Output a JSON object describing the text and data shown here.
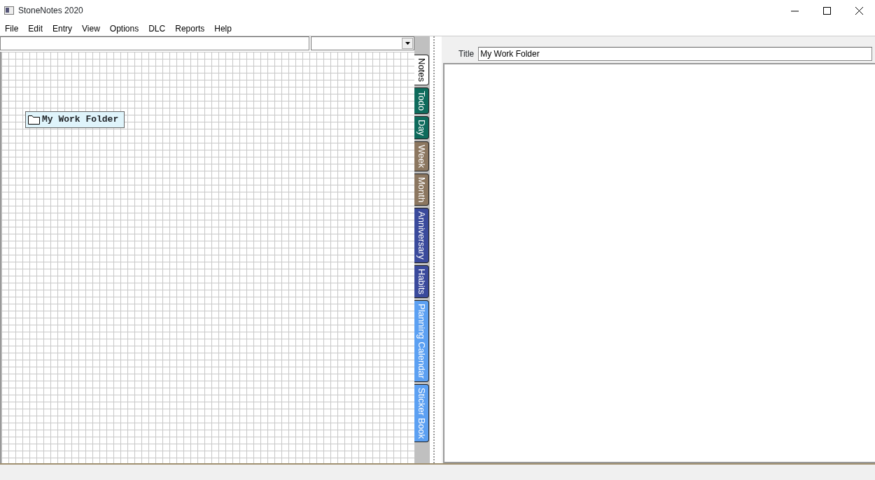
{
  "window": {
    "title": "StoneNotes 2020"
  },
  "menu": [
    "File",
    "Edit",
    "Entry",
    "View",
    "Options",
    "DLC",
    "Reports",
    "Help"
  ],
  "canvas": {
    "items": [
      {
        "kind": "folder",
        "label": "My Work Folder",
        "selected": true
      }
    ]
  },
  "tabs": [
    {
      "label": "Notes",
      "selected": true,
      "color": "#ffffff"
    },
    {
      "label": "Todo",
      "selected": false,
      "color": "#0e6b5c"
    },
    {
      "label": "Day",
      "selected": false,
      "color": "#0e6b5c"
    },
    {
      "label": "Week",
      "selected": false,
      "color": "#8c7760"
    },
    {
      "label": "Month",
      "selected": false,
      "color": "#8c7760"
    },
    {
      "label": "Anniversary",
      "selected": false,
      "color": "#3a4a9c"
    },
    {
      "label": "Habits",
      "selected": false,
      "color": "#3a4a9c"
    },
    {
      "label": "Planning Calendar",
      "selected": false,
      "color": "#5ca0f2"
    },
    {
      "label": "Sticker Book",
      "selected": false,
      "color": "#5ca0f2"
    }
  ],
  "detail": {
    "title_label": "Title",
    "title_value": "My Work Folder"
  }
}
